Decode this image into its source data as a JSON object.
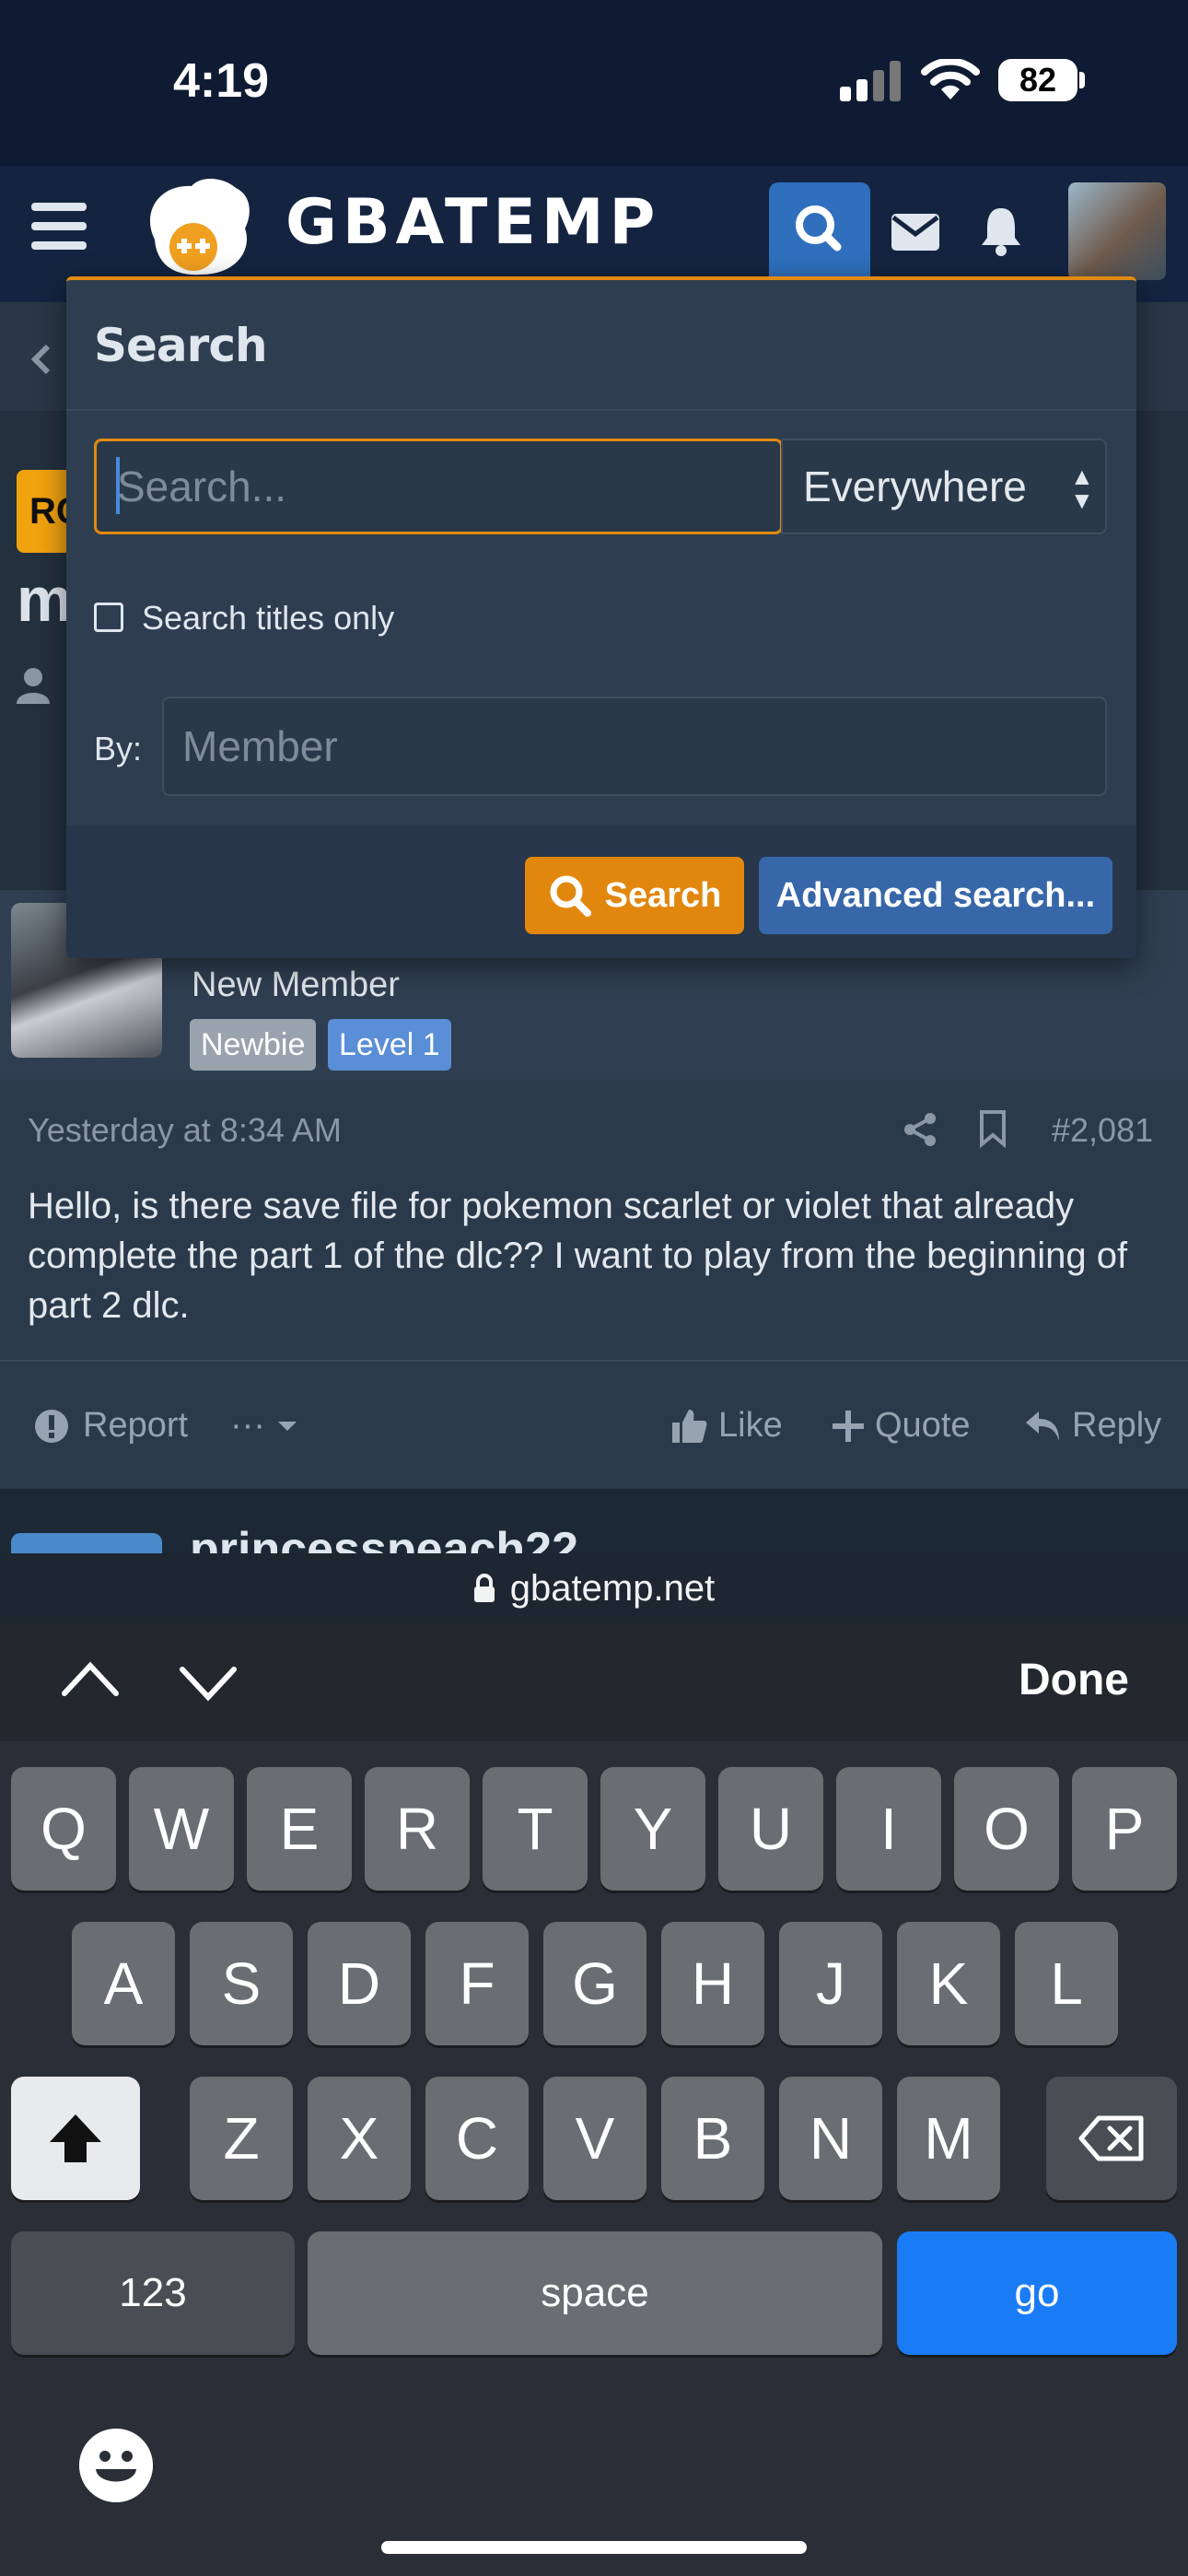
{
  "status_bar": {
    "time": "4:19",
    "battery": "82"
  },
  "header": {
    "logo_text": "GBATEMP"
  },
  "page": {
    "tag_partial": "RC",
    "title_partial": "m"
  },
  "post": {
    "user_title": "New Member",
    "badges": [
      "Newbie",
      "Level 1"
    ],
    "time": "Yesterday at 8:34 AM",
    "number": "#2,081",
    "body": "Hello, is there save file for pokemon scarlet or violet that already complete the part 1 of the dlc?? I want to play from the beginning of part 2 dlc.",
    "actions": {
      "report": "Report",
      "more": "···",
      "like": "Like",
      "quote": "Quote",
      "reply": "Reply"
    },
    "next_user_partial": "princesspeach22"
  },
  "search_panel": {
    "heading": "Search",
    "query_placeholder": "Search...",
    "scope": "Everywhere",
    "titles_only_label": "Search titles only",
    "by_label": "By:",
    "member_placeholder": "Member",
    "search_button": "Search",
    "advanced_button": "Advanced search..."
  },
  "browser": {
    "url": "gbatemp.net"
  },
  "keyboard": {
    "done": "Done",
    "row1": [
      "Q",
      "W",
      "E",
      "R",
      "T",
      "Y",
      "U",
      "I",
      "O",
      "P"
    ],
    "row2": [
      "A",
      "S",
      "D",
      "F",
      "G",
      "H",
      "J",
      "K",
      "L"
    ],
    "row3": [
      "Z",
      "X",
      "C",
      "V",
      "B",
      "N",
      "M"
    ],
    "numbers_key": "123",
    "space_key": "space",
    "go_key": "go"
  }
}
